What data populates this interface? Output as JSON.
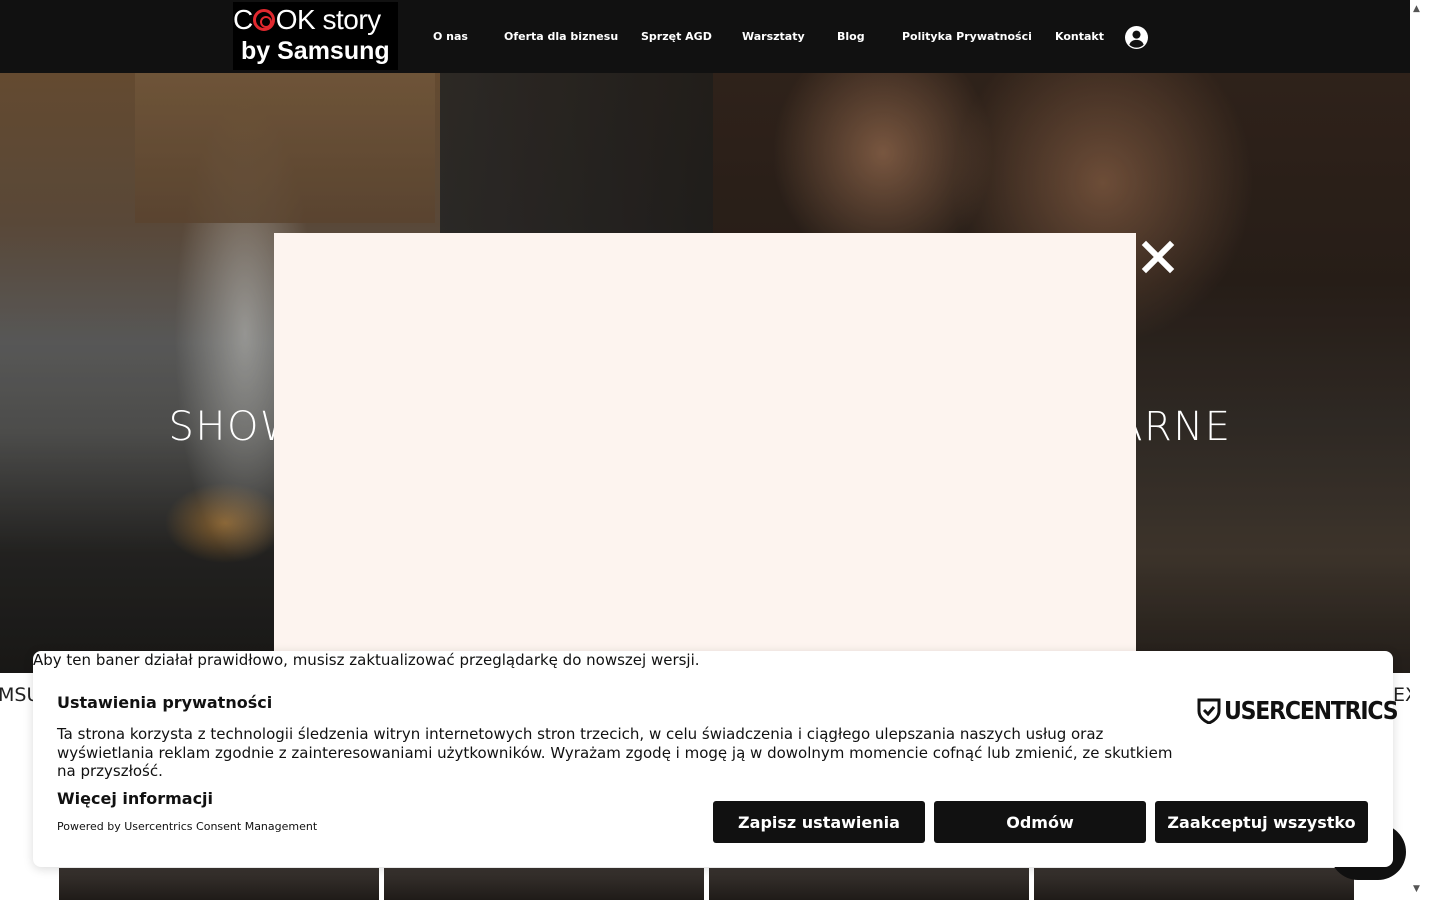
{
  "header": {
    "logo_line1": "OK story",
    "logo_line2": "by Samsung",
    "nav": [
      "O nas",
      "Oferta dla biznesu",
      "Sprzęt AGD",
      "Warsztaty",
      "Blog",
      "Polityka Prywatności",
      "Kontakt"
    ],
    "user_icon": "user-icon"
  },
  "hero": {
    "title": "SHOWROOM SAMSUNG & WARSZTATY KULINARNE"
  },
  "ticker": {
    "left_fragment": "MSU",
    "right_fragment": "EX"
  },
  "modal": {
    "close_icon": "close-icon"
  },
  "consent": {
    "browser_warning": "Aby ten baner działał prawidłowo, musisz zaktualizować przeglądarkę do nowszej wersji.",
    "title": "Ustawienia prywatności",
    "text": "Ta strona korzysta z technologii śledzenia witryn internetowych stron trzecich, w celu świadczenia i ciągłego ulepszania naszych usług oraz wyświetlania reklam zgodnie z zainteresowaniami użytkowników. Wyrażam zgodę i mogę ją w dowolnym momencie cofnąć lub zmienić, ze skutkiem na przyszłość.",
    "more_info": "Więcej informacji",
    "powered_by": "Powered by Usercentrics Consent Management",
    "brand": "USERCENTRICS",
    "buttons": {
      "save": "Zapisz ustawienia",
      "deny": "Odmów",
      "accept": "Zaakceptuj wszystko"
    }
  },
  "colors": {
    "header_bg": "#111111",
    "logo_accent": "#e0282e",
    "modal_bg": "#fdf4ef",
    "button_bg": "#111111"
  }
}
